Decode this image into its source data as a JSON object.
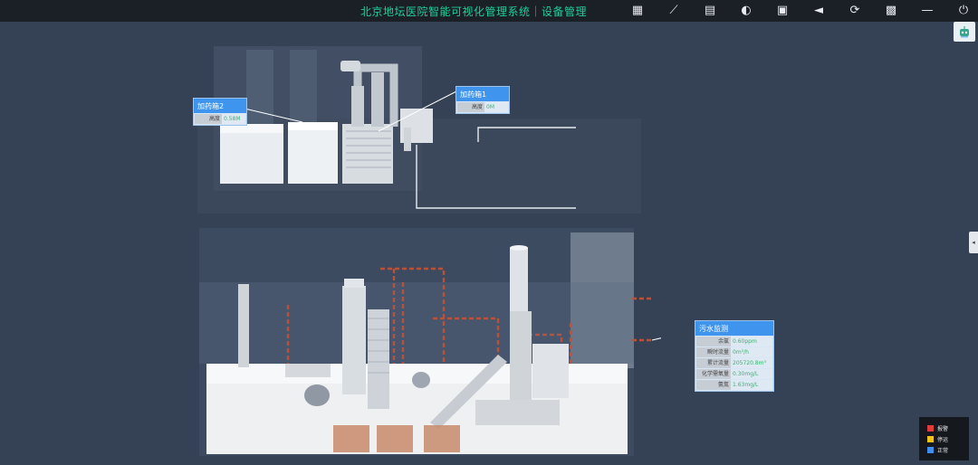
{
  "app": {
    "title": "北京地坛医院智能可视化管理系统｜设备管理"
  },
  "toolbar": [
    {
      "name": "report-icon",
      "glyph": "▦"
    },
    {
      "name": "ruler-icon",
      "glyph": "⟋"
    },
    {
      "name": "export-icon",
      "glyph": "▤"
    },
    {
      "name": "toggle-icon",
      "glyph": "◐"
    },
    {
      "name": "screenshot-icon",
      "glyph": "▣"
    },
    {
      "name": "navigate-icon",
      "glyph": "◄"
    },
    {
      "name": "refresh-icon",
      "glyph": "⟳"
    },
    {
      "name": "grid-menu-icon",
      "glyph": "▩"
    },
    {
      "name": "minimize-icon",
      "glyph": "—"
    },
    {
      "name": "power-icon",
      "glyph": "⏻"
    }
  ],
  "side_button": {
    "icon": "robot-icon"
  },
  "edge_tab": {
    "glyph": "◂"
  },
  "callouts": {
    "dosing_box_2": {
      "title": "加药箱2",
      "rows": [
        {
          "key": "高度",
          "value": "0.58M"
        }
      ]
    },
    "dosing_box_1": {
      "title": "加药箱1",
      "rows": [
        {
          "key": "高度",
          "value": "0M"
        }
      ]
    },
    "sewage_monitor": {
      "title": "污水监测",
      "rows": [
        {
          "key": "余氯",
          "value": "0.60ppm"
        },
        {
          "key": "瞬时流量",
          "value": "0m³/h"
        },
        {
          "key": "累计流量",
          "value": "205720.8m³"
        },
        {
          "key": "化学需氧量",
          "value": "0.30mg/L"
        },
        {
          "key": "氨氮",
          "value": "1.63mg/L"
        }
      ]
    }
  },
  "legend": [
    {
      "label": "报警",
      "color": "#e23b3b"
    },
    {
      "label": "停运",
      "color": "#f2c318"
    },
    {
      "label": "正常",
      "color": "#3f8ff0"
    }
  ]
}
